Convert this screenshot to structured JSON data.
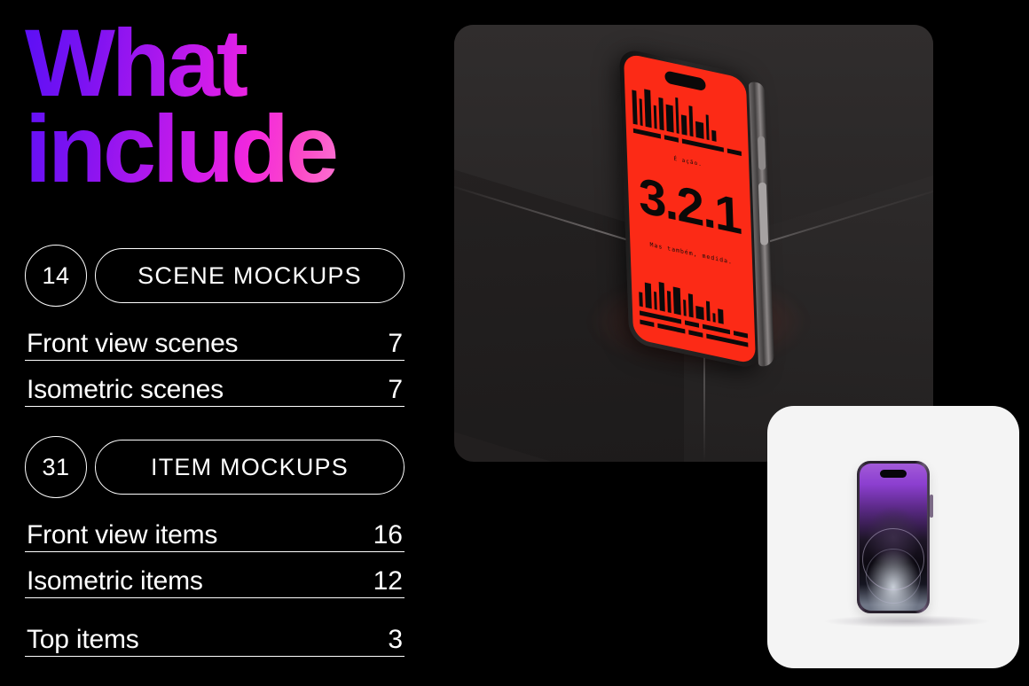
{
  "headline": "What\ninclude",
  "theme": {
    "background": "#000000",
    "text": "#ffffff",
    "gradient_start": "#5B10F5",
    "gradient_mid": "#F429DC",
    "gradient_end": "#FDD3EC",
    "screen_red": "#FC2A16",
    "card_white": "#F4F4F4",
    "stone_dark": "#2A2828"
  },
  "groups": [
    {
      "count": "14",
      "title": "SCENE MOCKUPS",
      "rows": [
        {
          "label": "Front view scenes",
          "value": "7",
          "spaced": false
        },
        {
          "label": "Isometric scenes",
          "value": "7",
          "spaced": false
        }
      ]
    },
    {
      "count": "31",
      "title": "ITEM MOCKUPS",
      "rows": [
        {
          "label": "Front view items",
          "value": "16",
          "spaced": false
        },
        {
          "label": "Isometric items",
          "value": "12",
          "spaced": false
        },
        {
          "label": "Top items",
          "value": "3",
          "spaced": true
        }
      ]
    }
  ],
  "scene": {
    "name": "isometric-phone-on-dark-stone",
    "phone_screen": {
      "line_top": "É ação.",
      "countdown": "3.2.1",
      "line_bottom": "Mas também, medida."
    }
  },
  "card": {
    "name": "front-view-phone-on-white",
    "device_color": "deep-purple"
  }
}
